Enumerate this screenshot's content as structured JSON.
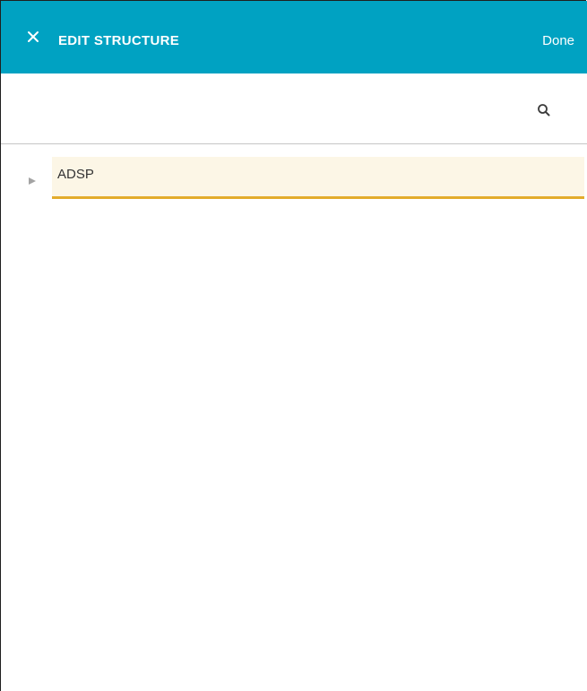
{
  "header": {
    "close_icon": "close-icon",
    "title": "EDIT STRUCTURE",
    "done_label": "Done"
  },
  "search": {
    "icon": "search-icon"
  },
  "tree": {
    "nodes": [
      {
        "label": "ADSP",
        "expanded": false,
        "selected": true,
        "toggle_icon": "caret-right-icon"
      }
    ]
  },
  "colors": {
    "header_bg": "#00a2c2",
    "header_text": "#ffffff",
    "selected_bg": "#fcf6e6",
    "selected_underline": "#e3ac2c",
    "divider": "#c6c6c6"
  }
}
